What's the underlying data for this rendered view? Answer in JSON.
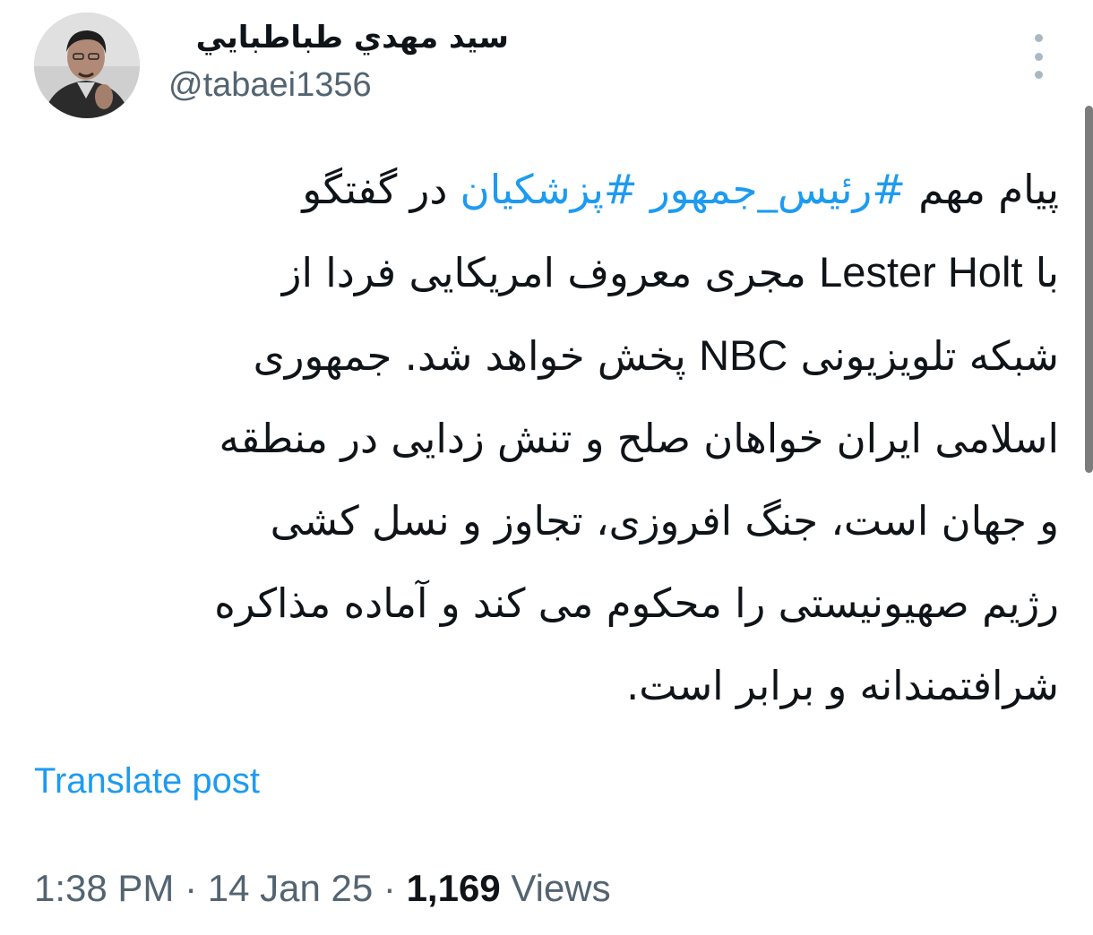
{
  "author": {
    "display_name": "سيد مهدي طباطبايي",
    "handle": "@tabaei1356"
  },
  "post": {
    "lines": [
      [
        {
          "t": "پیام مهم ",
          "type": "text"
        },
        {
          "t": "#رئیس_جمهور",
          "type": "hashtag"
        },
        {
          "t": " ",
          "type": "text"
        },
        {
          "t": "#پزشکیان",
          "type": "hashtag"
        },
        {
          "t": " در گفتگو",
          "type": "text"
        }
      ],
      [
        {
          "t": "با ",
          "type": "text"
        },
        {
          "t": "Lester Holt",
          "type": "latin"
        },
        {
          "t": " مجری معروف امریکایی فردا از",
          "type": "text"
        }
      ],
      [
        {
          "t": "شبکه تلویزیونی ",
          "type": "text"
        },
        {
          "t": "NBC",
          "type": "latin"
        },
        {
          "t": " پخش خواهد شد. جمهوری",
          "type": "text"
        }
      ],
      [
        {
          "t": "اسلامی ایران خواهان صلح و تنش زدایی در منطقه",
          "type": "text"
        }
      ],
      [
        {
          "t": "و جهان است، جنگ افروزی، تجاوز و نسل کشی",
          "type": "text"
        }
      ],
      [
        {
          "t": "رژیم صهیونیستی را محکوم می کند و آماده مذاکره",
          "type": "text"
        }
      ],
      [
        {
          "t": "شرافتمندانه و برابر است.",
          "type": "text"
        }
      ]
    ],
    "translate_label": "Translate post",
    "time": "1:38 PM",
    "date": "14 Jan 25",
    "separator": " · ",
    "views_count": "1,169",
    "views_label": " Views"
  },
  "colors": {
    "link": "#1d9bf0",
    "secondary_text": "#536471",
    "primary_text": "#0f1419"
  },
  "icons": {
    "more": "more-vertical-icon"
  }
}
